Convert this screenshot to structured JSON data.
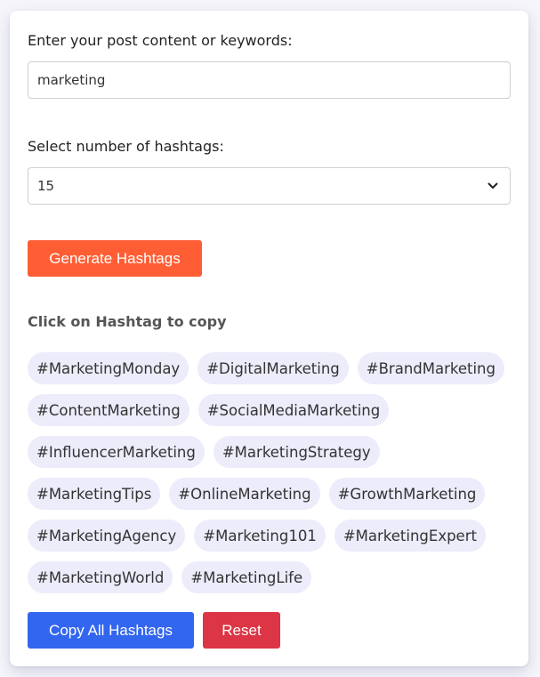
{
  "form": {
    "content_label": "Enter your post content or keywords:",
    "content_value": "marketing",
    "count_label": "Select number of hashtags:",
    "count_value": "15",
    "generate_label": "Generate Hashtags"
  },
  "results": {
    "hint": "Click on Hashtag to copy",
    "hashtags": [
      "#MarketingMonday",
      "#DigitalMarketing",
      "#BrandMarketing",
      "#ContentMarketing",
      "#SocialMediaMarketing",
      "#InfluencerMarketing",
      "#MarketingStrategy",
      "#MarketingTips",
      "#OnlineMarketing",
      "#GrowthMarketing",
      "#MarketingAgency",
      "#Marketing101",
      "#MarketingExpert",
      "#MarketingWorld",
      "#MarketingLife"
    ]
  },
  "actions": {
    "copy_all_label": "Copy All Hashtags",
    "reset_label": "Reset"
  },
  "colors": {
    "generate": "#ff5e35",
    "copy_all": "#3366ee",
    "reset": "#dc3545",
    "tag_bg": "#ececfb"
  },
  "icons": {
    "select_arrow": "chevron-down-icon"
  }
}
